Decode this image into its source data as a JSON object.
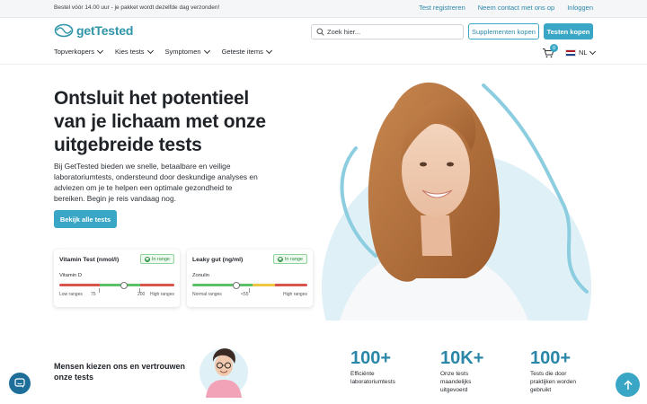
{
  "topbar": {
    "note": "Bestel vóór 14.00 uur - je pakket wordt dezelfde dag verzonden!",
    "links": [
      "Test registreren",
      "Neem contact met ons op",
      "Inloggen"
    ]
  },
  "header": {
    "logo_text": "getTested",
    "search_placeholder": "Zoek hier...",
    "supplements_button": "Supplementen kopen",
    "tests_button": "Testen kopen",
    "nav": [
      "Topverkopers",
      "Kies tests",
      "Symptomen",
      "Geteste items"
    ],
    "cart_count": "0",
    "language": "NL"
  },
  "hero": {
    "title": "Ontsluit het potentieel van je lichaam met onze uitgebreide tests",
    "description": "Bij GetTested bieden we snelle, betaalbare en veilige laboratoriumtests, ondersteund door deskundige analyses en adviezen om je te helpen een optimale gezondheid te bereiken. Begin je reis vandaag nog.",
    "cta": "Bekijk alle tests"
  },
  "cards": [
    {
      "title": "Vitamin Test (nmol/l)",
      "badge": "In range",
      "marker": "Vitamin D",
      "low_label": "Low ranges",
      "high_label": "High ranges",
      "tick_low": "75",
      "tick_high": "200"
    },
    {
      "title": "Leaky gut (ng/ml)",
      "badge": "In range",
      "marker": "Zonulin",
      "low_label": "Normal ranges",
      "high_label": "High ranges",
      "tick_high": "<55"
    }
  ],
  "stats": {
    "trust_text": "Mensen kiezen ons en vertrouwen onze tests",
    "items": [
      {
        "number": "100+",
        "label": "Efficiënte laboratoriumtests"
      },
      {
        "number": "10K+",
        "label": "Onze tests maandelijks uitgevoerd"
      },
      {
        "number": "100+",
        "label": "Tests die door praktijken worden gebruikt"
      }
    ]
  },
  "colors": {
    "accent": "#3aa6c5",
    "link": "#2b87a8",
    "range_red": "#d9534f",
    "range_green": "#5cc06b",
    "range_yellow": "#f0c542"
  },
  "icons": [
    "logo-icon",
    "search-icon",
    "chevron-down-icon",
    "cart-icon",
    "flag-nl-icon",
    "check-circle-icon",
    "chat-icon",
    "arrow-up-icon"
  ]
}
